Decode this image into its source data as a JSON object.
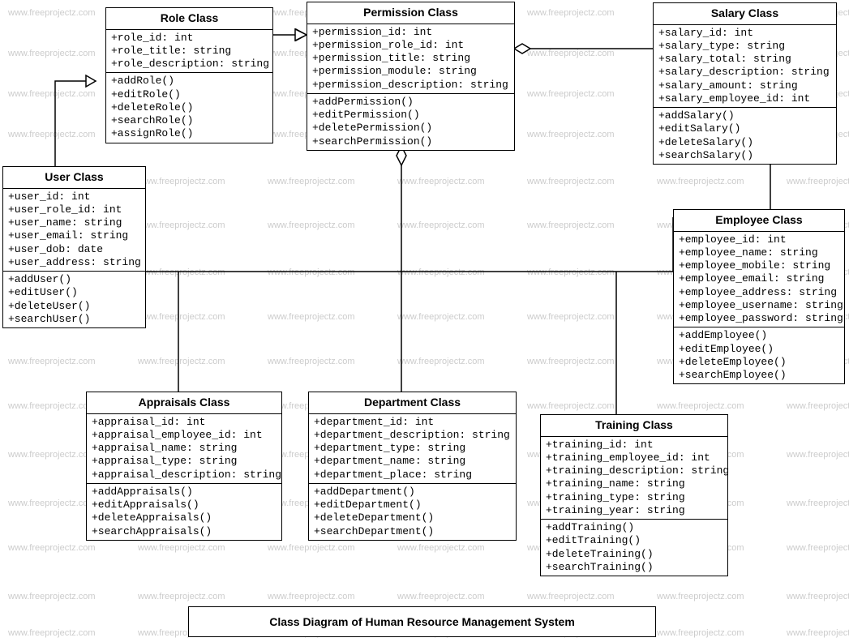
{
  "watermark": "www.freeprojectz.com",
  "title": "Class Diagram of Human Resource Management System",
  "classes": {
    "role": {
      "name": "Role Class",
      "attrs": [
        "+role_id: int",
        "+role_title: string",
        "+role_description: string"
      ],
      "ops": [
        "+addRole()",
        "+editRole()",
        "+deleteRole()",
        "+searchRole()",
        "+assignRole()"
      ]
    },
    "permission": {
      "name": "Permission Class",
      "attrs": [
        "+permission_id: int",
        "+permission_role_id: int",
        "+permission_title: string",
        "+permission_module: string",
        "+permission_description: string"
      ],
      "ops": [
        "+addPermission()",
        "+editPermission()",
        "+deletePermission()",
        "+searchPermission()"
      ]
    },
    "salary": {
      "name": "Salary Class",
      "attrs": [
        "+salary_id: int",
        "+salary_type: string",
        "+salary_total: string",
        "+salary_description: string",
        "+salary_amount: string",
        "+salary_employee_id: int"
      ],
      "ops": [
        "+addSalary()",
        "+editSalary()",
        "+deleteSalary()",
        "+searchSalary()"
      ]
    },
    "user": {
      "name": "User Class",
      "attrs": [
        "+user_id: int",
        "+user_role_id: int",
        "+user_name: string",
        "+user_email: string",
        "+user_dob: date",
        "+user_address: string"
      ],
      "ops": [
        "+addUser()",
        "+editUser()",
        "+deleteUser()",
        "+searchUser()"
      ]
    },
    "employee": {
      "name": "Employee Class",
      "attrs": [
        "+employee_id: int",
        "+employee_name: string",
        "+employee_mobile: string",
        "+employee_email: string",
        "+employee_address: string",
        "+employee_username: string",
        "+employee_password: string"
      ],
      "ops": [
        "+addEmployee()",
        "+editEmployee()",
        "+deleteEmployee()",
        "+searchEmployee()"
      ]
    },
    "appraisals": {
      "name": "Appraisals Class",
      "attrs": [
        "+appraisal_id: int",
        "+appraisal_employee_id: int",
        "+appraisal_name: string",
        "+appraisal_type: string",
        "+appraisal_description: string"
      ],
      "ops": [
        "+addAppraisals()",
        "+editAppraisals()",
        "+deleteAppraisals()",
        "+searchAppraisals()"
      ]
    },
    "department": {
      "name": "Department Class",
      "attrs": [
        "+department_id: int",
        "+department_description: string",
        "+department_type: string",
        "+department_name: string",
        "+department_place: string"
      ],
      "ops": [
        "+addDepartment()",
        "+editDepartment()",
        "+deleteDepartment()",
        "+searchDepartment()"
      ]
    },
    "training": {
      "name": "Training Class",
      "attrs": [
        "+training_id: int",
        "+training_employee_id: int",
        "+training_description: string",
        "+training_name: string",
        "+training_type: string",
        "+training_year: string"
      ],
      "ops": [
        "+addTraining()",
        "+editTraining()",
        "+deleteTraining()",
        "+searchTraining()"
      ]
    }
  }
}
